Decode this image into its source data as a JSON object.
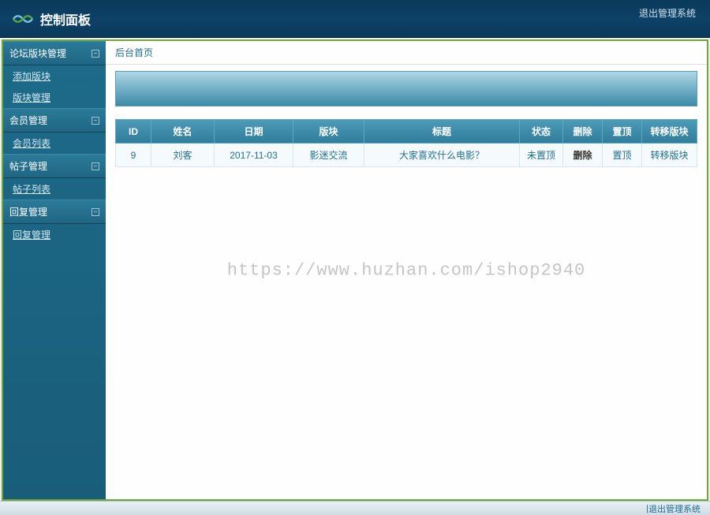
{
  "header": {
    "title": "控制面板",
    "logout_link": "退出管理系统"
  },
  "sidebar": {
    "groups": [
      {
        "label": "论坛版块管理",
        "items": [
          {
            "label": "添加版块"
          },
          {
            "label": "版块管理"
          }
        ]
      },
      {
        "label": "会员管理",
        "items": [
          {
            "label": "会员列表"
          }
        ]
      },
      {
        "label": "帖子管理",
        "items": [
          {
            "label": "帖子列表"
          }
        ]
      },
      {
        "label": "回复管理",
        "items": [
          {
            "label": "回复管理"
          }
        ]
      }
    ]
  },
  "breadcrumb": "后台首页",
  "watermark": "https://www.huzhan.com/ishop2940",
  "table": {
    "headers": [
      "ID",
      "姓名",
      "日期",
      "版块",
      "标题",
      "状态",
      "删除",
      "置顶",
      "转移版块"
    ],
    "rows": [
      {
        "id": "9",
        "name": "刘客",
        "date": "2017-11-03",
        "section": "影迷交流",
        "title": "大家喜欢什么电影？",
        "status": "未置顶",
        "delete": "删除",
        "top": "置顶",
        "move": "转移版块"
      }
    ]
  },
  "footer": {
    "logout": "退出管理系统",
    "toggle": "«"
  }
}
